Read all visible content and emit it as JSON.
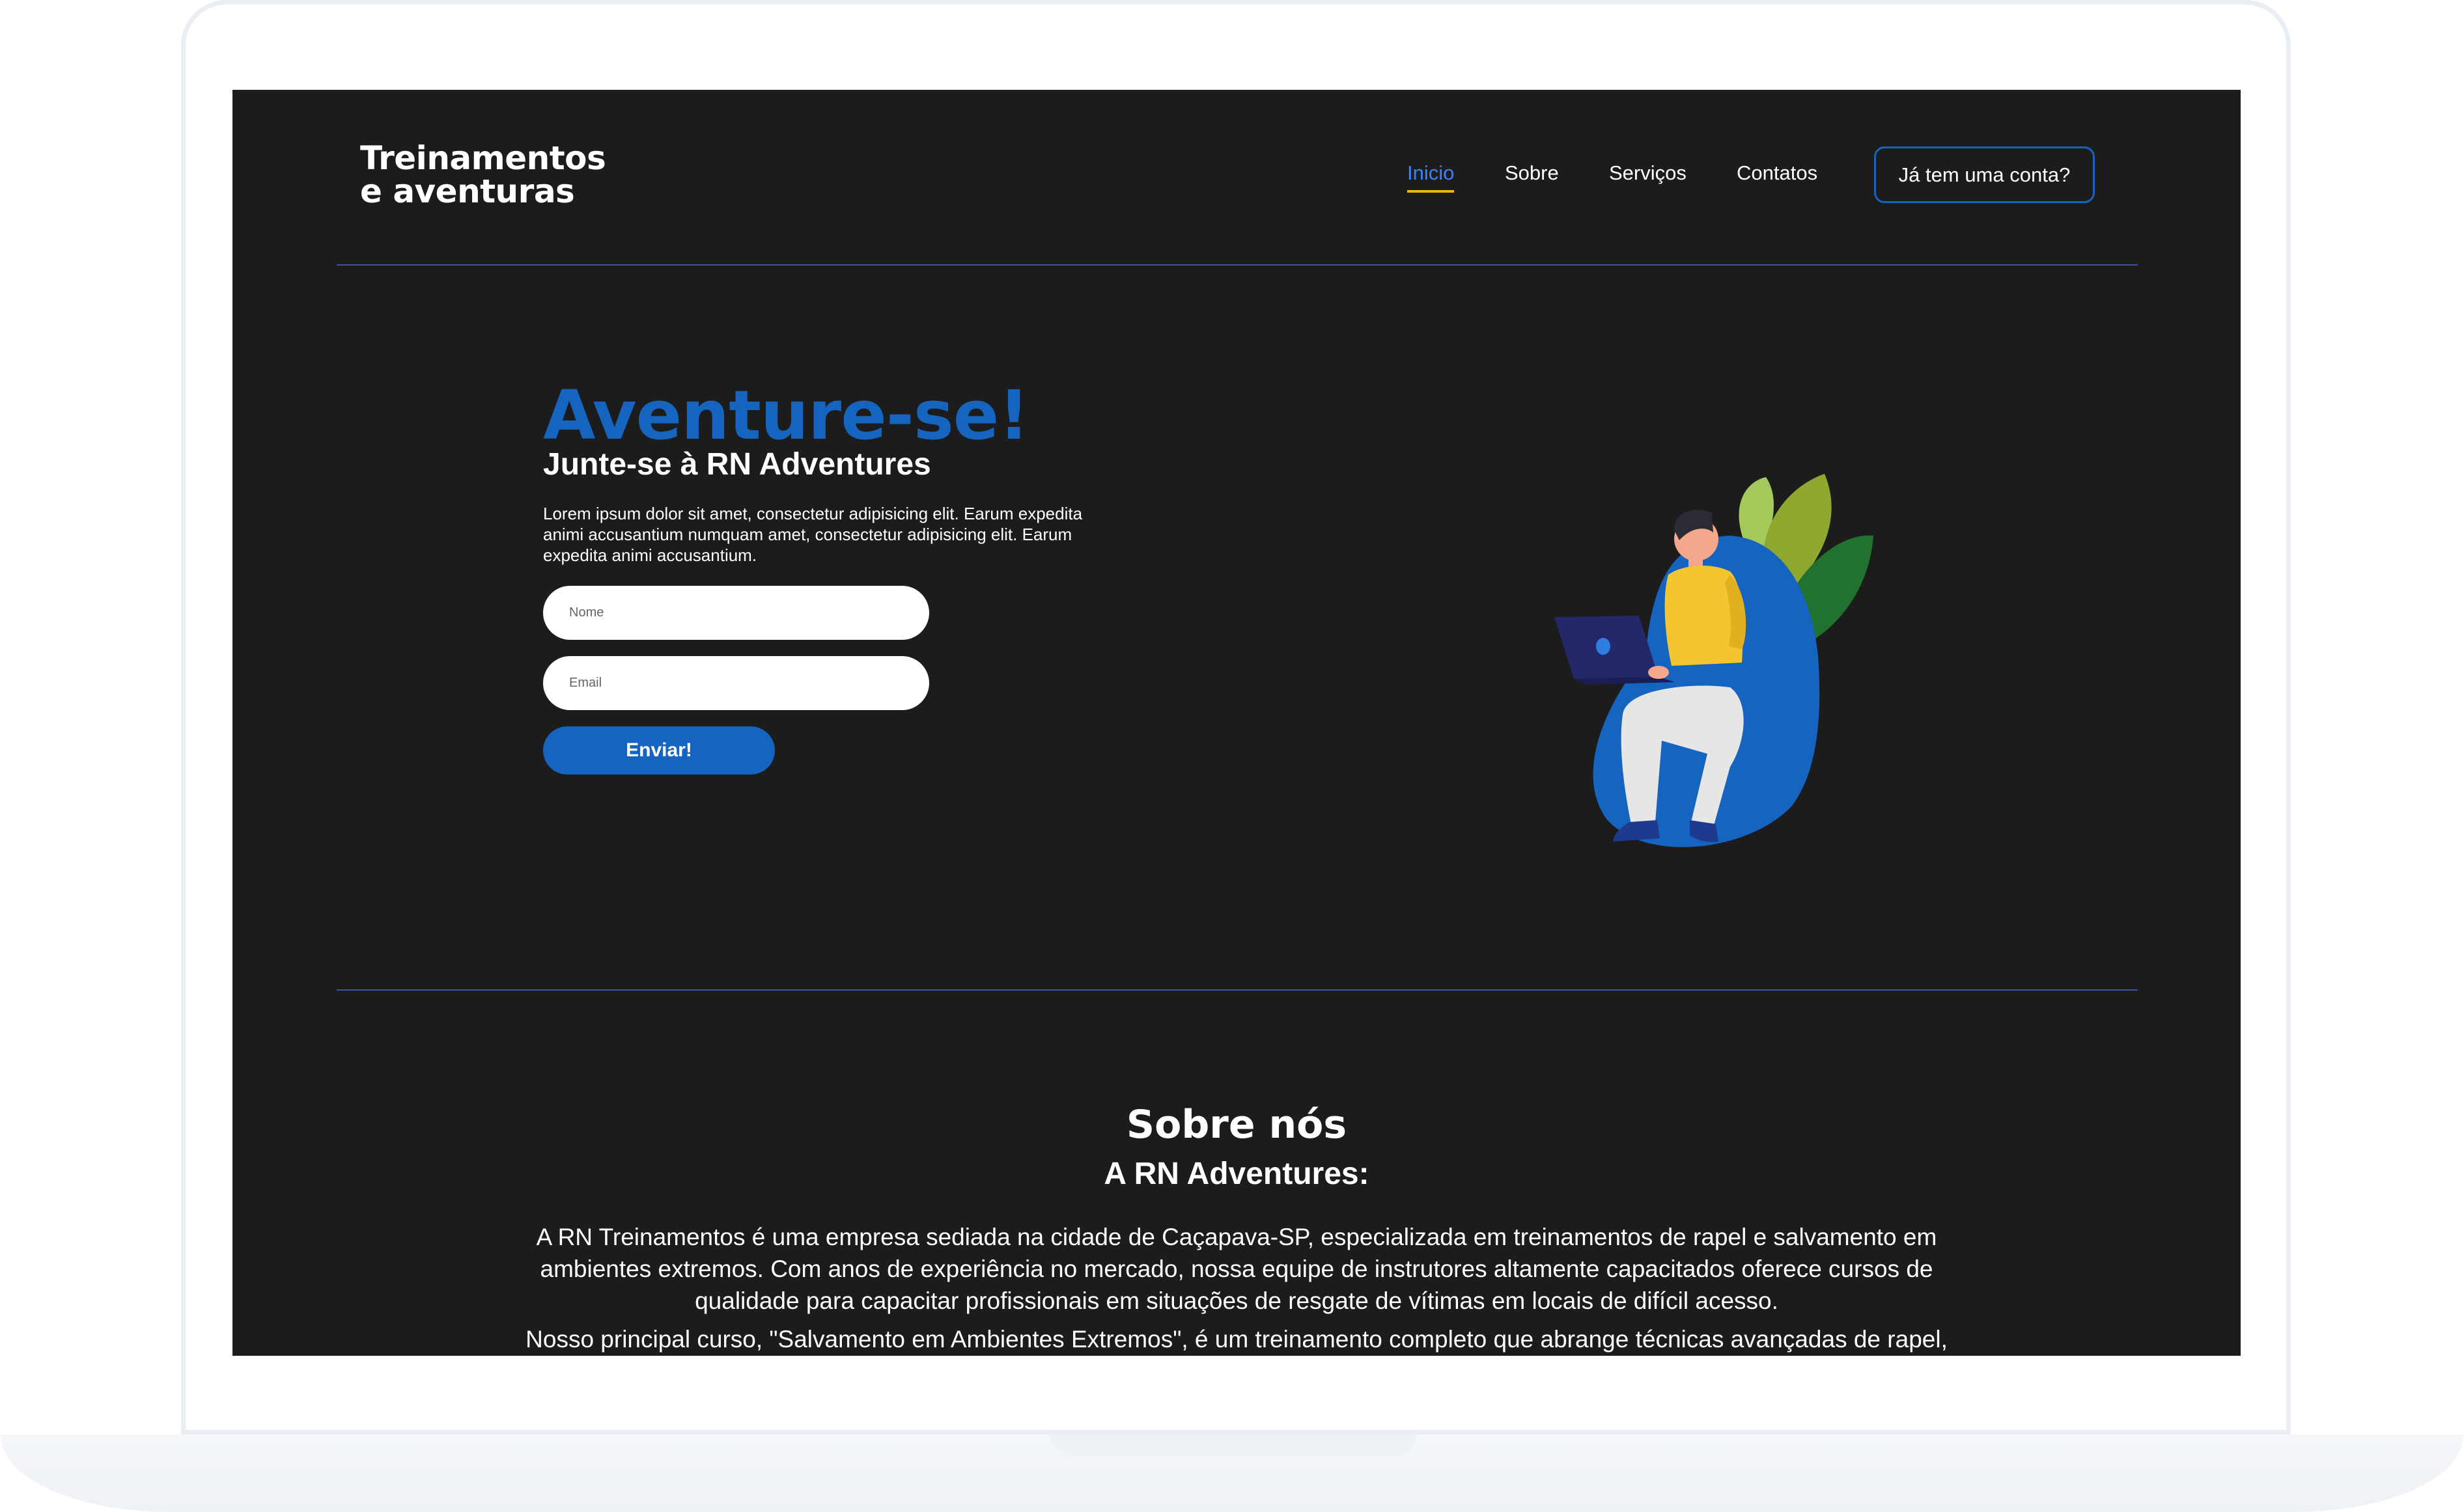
{
  "header": {
    "logo_line1": "Treinamentos",
    "logo_line2": "e aventuras",
    "nav": [
      {
        "label": "Inicio",
        "active": true
      },
      {
        "label": "Sobre",
        "active": false
      },
      {
        "label": "Serviços",
        "active": false
      },
      {
        "label": "Contatos",
        "active": false
      }
    ],
    "account_label": "Já tem uma conta?"
  },
  "hero": {
    "title": "Aventure-se!",
    "subtitle": "Junte-se à RN Adventures",
    "text": "Lorem ipsum dolor sit amet, consectetur adipisicing elit. Earum expedita animi accusantium numquam amet, consectetur adipisicing elit. Earum expedita animi accusantium.",
    "name_placeholder": "Nome",
    "email_placeholder": "Email",
    "submit_label": "Enviar!"
  },
  "about": {
    "title": "Sobre nós",
    "subtitle": "A RN Adventures:",
    "paragraph1": "A RN Treinamentos é uma empresa sediada na cidade de Caçapava-SP, especializada em treinamentos de rapel e salvamento em ambientes extremos. Com anos de experiência no mercado, nossa equipe de instrutores altamente capacitados oferece cursos de qualidade para capacitar profissionais em situações de resgate de vítimas em locais de difícil acesso.",
    "paragraph2": "Nosso principal curso, \"Salvamento em Ambientes Extremos\", é um treinamento completo que abrange técnicas avançadas de rapel,"
  },
  "colors": {
    "background": "#1c1c1c",
    "accent_blue": "#1565c0",
    "nav_active": "#3b82f6",
    "nav_underline": "#f2b705",
    "divider": "#3f4fb0"
  }
}
